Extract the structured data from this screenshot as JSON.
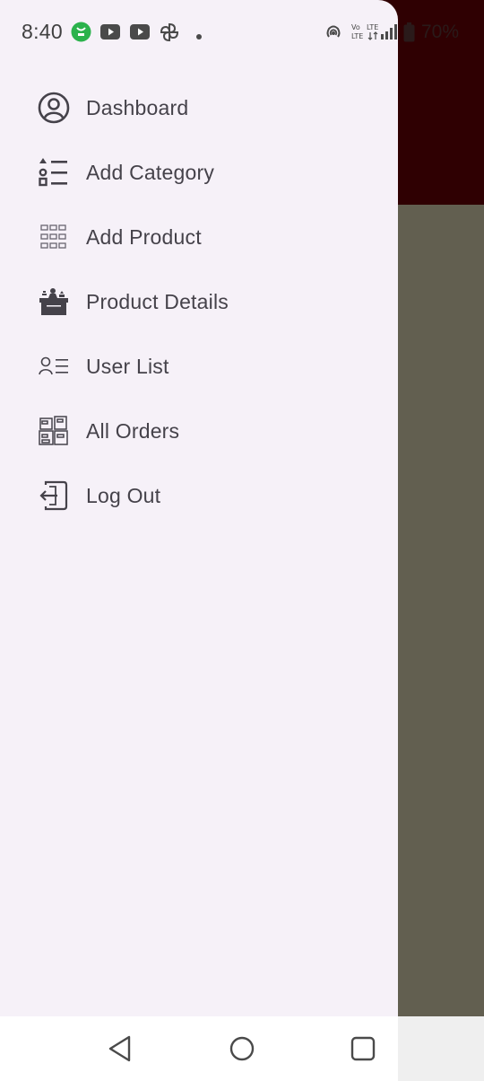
{
  "status_bar": {
    "time": "8:40",
    "battery": "70%",
    "icons": [
      "app-notification-icon",
      "youtube-icon",
      "youtube-icon",
      "pinwheel-icon",
      "dot-icon",
      "hotspot-icon",
      "volte-icon",
      "lte-signal-icon",
      "battery-icon"
    ]
  },
  "drawer": {
    "items": [
      {
        "label": "Dashboard",
        "icon": "account-circle-icon"
      },
      {
        "label": "Add Category",
        "icon": "category-list-icon"
      },
      {
        "label": "Add Product",
        "icon": "grid-icon"
      },
      {
        "label": "Product Details",
        "icon": "desk-icon"
      },
      {
        "label": "User List",
        "icon": "user-list-icon"
      },
      {
        "label": "All Orders",
        "icon": "packages-icon"
      },
      {
        "label": "Log Out",
        "icon": "logout-icon"
      }
    ]
  },
  "nav_bar": {
    "buttons": [
      "back",
      "home",
      "recents"
    ]
  },
  "colors": {
    "drawer_bg": "#f6f1f8",
    "text": "#45424a",
    "scrim_top": "#2f0002",
    "scrim_bottom": "#625f50"
  }
}
